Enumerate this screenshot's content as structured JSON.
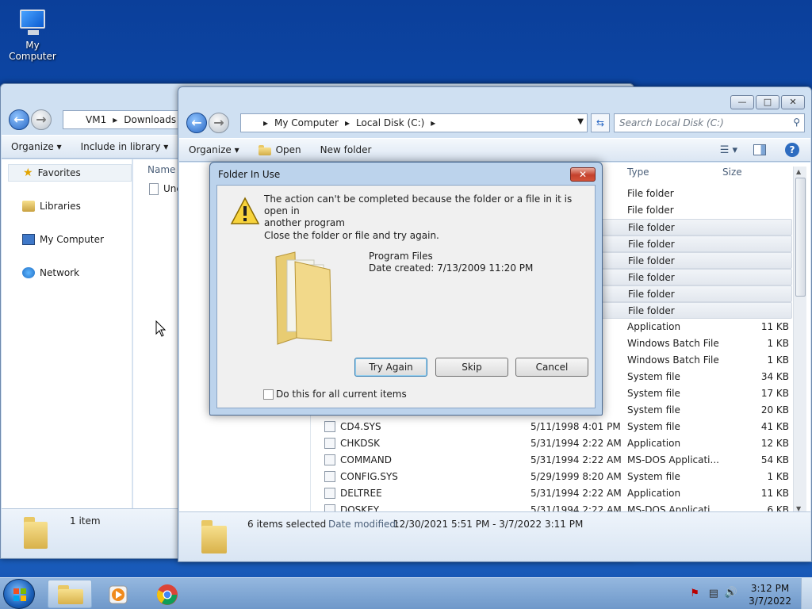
{
  "desktop": {
    "icon_label": "My Computer"
  },
  "back_window": {
    "breadcrumbs": [
      "VM1",
      "Downloads"
    ],
    "toolbar": {
      "organize": "Organize",
      "include_in_library": "Include in library"
    },
    "nav": {
      "favorites": "Favorites",
      "libraries": "Libraries",
      "my_computer": "My Computer",
      "network": "Network"
    },
    "column_name": "Name",
    "row_label": "Unc",
    "status": "1 item"
  },
  "front_window": {
    "breadcrumbs": [
      "My Computer",
      "Local Disk (C:)"
    ],
    "search_placeholder": "Search Local Disk (C:)",
    "toolbar": {
      "organize": "Organize",
      "open": "Open",
      "new_folder": "New folder"
    },
    "columns": {
      "type": "Type",
      "size": "Size"
    },
    "rows": [
      {
        "name": "",
        "date": "PM",
        "type": "File folder",
        "size": "",
        "selected": false
      },
      {
        "name": "",
        "date": "",
        "type": "File folder",
        "size": "",
        "selected": false
      },
      {
        "name": "",
        "date": "",
        "type": "File folder",
        "size": "",
        "selected": true
      },
      {
        "name": "",
        "date": "",
        "type": "File folder",
        "size": "",
        "selected": true
      },
      {
        "name": "",
        "date": "",
        "type": "File folder",
        "size": "",
        "selected": true
      },
      {
        "name": "",
        "date": "PM",
        "type": "File folder",
        "size": "",
        "selected": true
      },
      {
        "name": "",
        "date": "",
        "type": "File folder",
        "size": "",
        "selected": true
      },
      {
        "name": "",
        "date": "PM",
        "type": "File folder",
        "size": "",
        "selected": true
      },
      {
        "name": "",
        "date": "M",
        "type": "Application",
        "size": "11 KB",
        "selected": false
      },
      {
        "name": "",
        "date": "PM",
        "type": "Windows Batch File",
        "size": "1 KB",
        "selected": false
      },
      {
        "name": "",
        "date": "PM",
        "type": "Windows Batch File",
        "size": "1 KB",
        "selected": false
      },
      {
        "name": "",
        "date": "M",
        "type": "System file",
        "size": "34 KB",
        "selected": false
      },
      {
        "name": "",
        "date": "PM",
        "type": "System file",
        "size": "17 KB",
        "selected": false
      },
      {
        "name": "",
        "date": "M",
        "type": "System file",
        "size": "20 KB",
        "selected": false
      },
      {
        "name": "CD4.SYS",
        "date": "5/11/1998 4:01 PM",
        "type": "System file",
        "size": "41 KB",
        "selected": false
      },
      {
        "name": "CHKDSK",
        "date": "5/31/1994 2:22 AM",
        "type": "Application",
        "size": "12 KB",
        "selected": false
      },
      {
        "name": "COMMAND",
        "date": "5/31/1994 2:22 AM",
        "type": "MS-DOS Applicati...",
        "size": "54 KB",
        "selected": false
      },
      {
        "name": "CONFIG.SYS",
        "date": "5/29/1999 8:20 AM",
        "type": "System file",
        "size": "1 KB",
        "selected": false
      },
      {
        "name": "DELTREE",
        "date": "5/31/1994 2:22 AM",
        "type": "Application",
        "size": "11 KB",
        "selected": false
      },
      {
        "name": "DOSKEY",
        "date": "5/31/1994 2:22 AM",
        "type": "MS-DOS Applicati...",
        "size": "6 KB",
        "selected": false
      }
    ],
    "status_selected": "6 items selected",
    "status_modified_label": "Date modified:",
    "status_modified_value": "12/30/2021 5:51 PM - 3/7/2022 3:11 PM"
  },
  "dialog": {
    "title": "Folder In Use",
    "message_line1": "The action can't be completed because the folder or a file in it is open in",
    "message_line2": "another program",
    "instruction": "Close the folder or file and try again.",
    "item_name": "Program Files",
    "item_date": "Date created: 7/13/2009 11:20 PM",
    "buttons": {
      "try_again": "Try Again",
      "skip": "Skip",
      "cancel": "Cancel"
    },
    "checkbox_label": "Do this for all current items",
    "checkbox_checked": false
  },
  "taskbar": {
    "time": "3:12 PM",
    "date": "3/7/2022"
  }
}
